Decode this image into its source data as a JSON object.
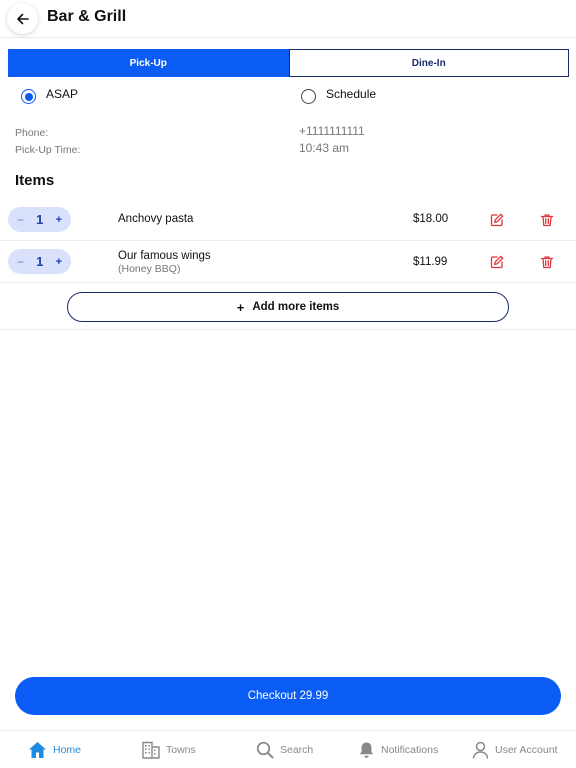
{
  "header": {
    "title": "Bar & Grill",
    "back_icon": "arrow-left-icon"
  },
  "order_type": {
    "tabs": [
      {
        "label": "Pick-Up",
        "active": true
      },
      {
        "label": "Dine-In",
        "active": false
      }
    ]
  },
  "timing": {
    "options": [
      {
        "label": "ASAP",
        "checked": true
      },
      {
        "label": "Schedule",
        "checked": false
      }
    ]
  },
  "info": {
    "phone_label": "Phone:",
    "phone_value": "+1111111111",
    "time_label": "Pick-Up Time:",
    "time_value": "10:43 am"
  },
  "items_heading": "Items",
  "items": [
    {
      "qty": "1",
      "name": "Anchovy pasta",
      "option": "",
      "price": "$18.00"
    },
    {
      "qty": "1",
      "name": "Our famous wings",
      "option": "(Honey BBQ)",
      "price": "$11.99"
    }
  ],
  "stepper": {
    "minus": "−",
    "plus": "+"
  },
  "add_more": {
    "icon": "+",
    "label": "Add more items"
  },
  "checkout": {
    "label": "Checkout 29.99"
  },
  "tabbar": {
    "items": [
      {
        "label": "Home",
        "icon": "home-icon",
        "active": true
      },
      {
        "label": "Towns",
        "icon": "building-icon",
        "active": false
      },
      {
        "label": "Search",
        "icon": "search-icon",
        "active": false
      },
      {
        "label": "Notifications",
        "icon": "bell-icon",
        "active": false
      },
      {
        "label": "User Account",
        "icon": "user-icon",
        "active": false
      }
    ]
  },
  "colors": {
    "primary": "#0a5cf5",
    "navy": "#1a2a6e",
    "danger": "#e0343a",
    "tab_active": "#1e8be0",
    "stepper_bg": "#d9e1fb"
  }
}
